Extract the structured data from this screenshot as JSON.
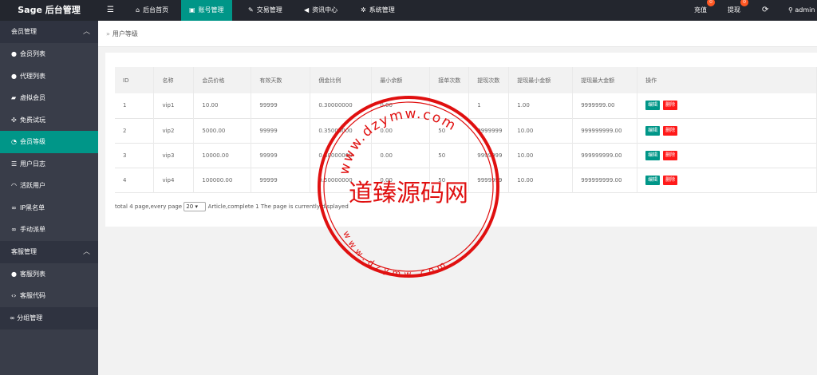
{
  "app": {
    "title": "Sage 后台管理"
  },
  "topnav": {
    "toggle_icon": "menu-icon",
    "items": [
      {
        "label": "后台首页",
        "icon": "home-icon",
        "active": false
      },
      {
        "label": "账号管理",
        "icon": "account-card-icon",
        "active": true
      },
      {
        "label": "交易管理",
        "icon": "wrench-icon",
        "active": false
      },
      {
        "label": "资讯中心",
        "icon": "megaphone-icon",
        "active": false
      },
      {
        "label": "系统管理",
        "icon": "gears-icon",
        "active": false
      }
    ],
    "right": {
      "recharge": {
        "label": "充值",
        "badge": "0"
      },
      "withdraw": {
        "label": "提现",
        "badge": "0"
      },
      "refresh_icon": "refresh-icon",
      "user": {
        "label": "admin",
        "icon": "user-icon"
      }
    }
  },
  "sidebar": {
    "groups": [
      {
        "label": "会员管理",
        "items": [
          {
            "label": "会员列表",
            "icon": "user-icon"
          },
          {
            "label": "代理列表",
            "icon": "users-icon"
          },
          {
            "label": "虚拟会员",
            "icon": "lock-icon"
          },
          {
            "label": "免费试玩",
            "icon": "bot-icon"
          },
          {
            "label": "会员等级",
            "icon": "dashboard-icon",
            "active": true
          },
          {
            "label": "用户日志",
            "icon": "log-icon"
          },
          {
            "label": "活跃用户",
            "icon": "wifi-icon"
          },
          {
            "label": "IP黑名单",
            "icon": "link-icon"
          },
          {
            "label": "手动派单",
            "icon": "link-icon"
          }
        ]
      },
      {
        "label": "客服管理",
        "items": [
          {
            "label": "客服列表",
            "icon": "support-icon"
          },
          {
            "label": "客服代码",
            "icon": "code-icon"
          }
        ]
      }
    ],
    "single": {
      "label": "分组管理",
      "icon": "link-icon"
    }
  },
  "breadcrumb": {
    "sep": "»",
    "label": "用户等级"
  },
  "table": {
    "headers": [
      "ID",
      "名称",
      "会员价格",
      "有效天数",
      "佣金比例",
      "最小余额",
      "接单次数",
      "提现次数",
      "提现最小金额",
      "提现最大金额",
      "操作"
    ],
    "rows": [
      {
        "id": "1",
        "name": "vip1",
        "price": "10.00",
        "days": "99999",
        "commission": "0.30000000",
        "min_balance": "0.00",
        "orders": "",
        "withdraw_times": "1",
        "withdraw_min": "1.00",
        "withdraw_max": "9999999.00"
      },
      {
        "id": "2",
        "name": "vip2",
        "price": "5000.00",
        "days": "99999",
        "commission": "0.35000000",
        "min_balance": "0.00",
        "orders": "50",
        "withdraw_times": "9999999",
        "withdraw_min": "10.00",
        "withdraw_max": "999999999.00"
      },
      {
        "id": "3",
        "name": "vip3",
        "price": "10000.00",
        "days": "99999",
        "commission": "0.40000000",
        "min_balance": "0.00",
        "orders": "50",
        "withdraw_times": "9999999",
        "withdraw_min": "10.00",
        "withdraw_max": "999999999.00"
      },
      {
        "id": "4",
        "name": "vip4",
        "price": "100000.00",
        "days": "99999",
        "commission": "0.50000000",
        "min_balance": "0.00",
        "orders": "50",
        "withdraw_times": "9999999",
        "withdraw_min": "10.00",
        "withdraw_max": "999999999.00"
      }
    ],
    "edit_label": "编辑",
    "delete_label": "删除"
  },
  "pager": {
    "prefix": "total 4 page,every page",
    "page_size": "20",
    "suffix": "Article,complete 1 The page is currently displayed"
  },
  "watermark": {
    "center": "道臻源码网",
    "top_arc": "www.dzymw.com",
    "bottom_arc": "www.dzymw.com",
    "color": "#e01010"
  },
  "colors": {
    "accent": "#009688",
    "topbar": "#23262e",
    "sidebar": "#393d49",
    "danger": "#ff1a1a",
    "badge": "#ff5722"
  }
}
